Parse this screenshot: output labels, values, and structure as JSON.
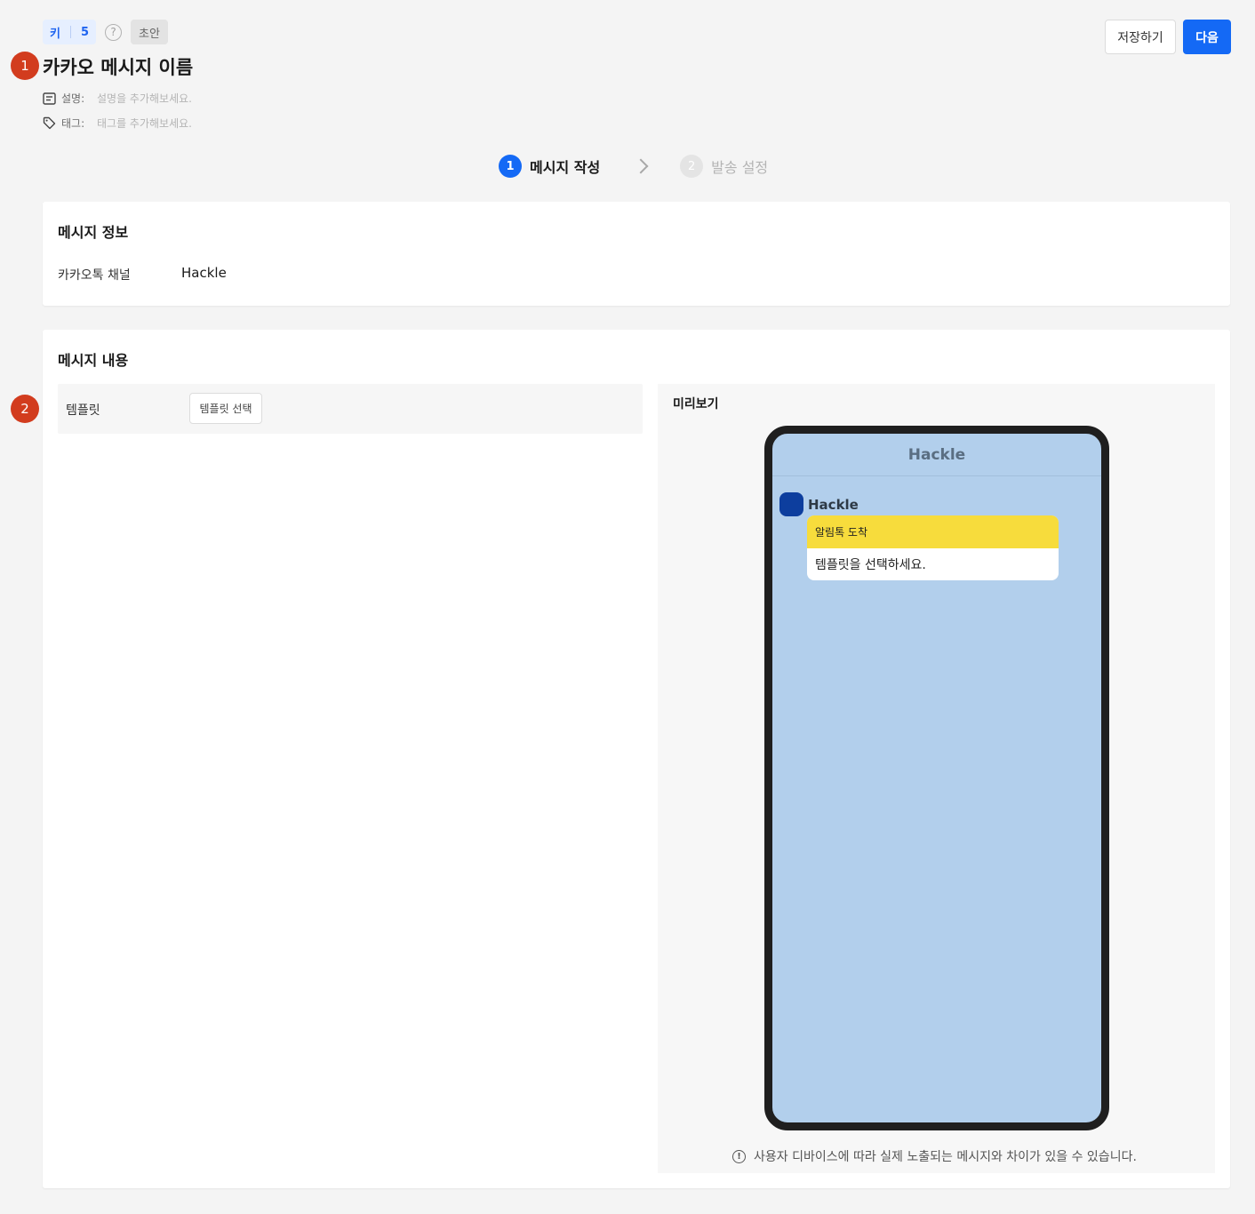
{
  "annotations": {
    "marker_1": "1",
    "marker_2": "2"
  },
  "header": {
    "key_label": "키",
    "key_value": "5",
    "help_icon": "?",
    "status": "초안",
    "title": "카카오 메시지 이름",
    "description_label": "설명:",
    "description_placeholder": "설명을 추가해보세요.",
    "tags_label": "태그:",
    "tags_placeholder": "태그를 추가해보세요."
  },
  "actions": {
    "save_label": "저장하기",
    "next_label": "다음"
  },
  "stepper": {
    "steps": [
      {
        "num": "1",
        "label": "메시지 작성",
        "state": "active"
      },
      {
        "num": "2",
        "label": "발송 설정",
        "state": "inactive"
      }
    ]
  },
  "message_info": {
    "title": "메시지 정보",
    "channel_label": "카카오톡 채널",
    "channel_value": "Hackle"
  },
  "message_content": {
    "title": "메시지 내용",
    "template_label": "템플릿",
    "template_button": "템플릿 선택"
  },
  "preview": {
    "title": "미리보기",
    "chat_header": "Hackle",
    "sender_name": "Hackle",
    "bubble_header": "알림톡 도착",
    "bubble_body": "템플릿을 선택하세요.",
    "notice_icon": "!",
    "notice": "사용자 디바이스에 따라 실제 노출되는 메시지와 차이가 있을 수 있습니다."
  },
  "colors": {
    "primary": "#1469f5",
    "marker": "#d23c1e",
    "chat_background": "#b2cfec",
    "bubble_header": "#f7dc3c",
    "avatar": "#0d3e9e"
  }
}
